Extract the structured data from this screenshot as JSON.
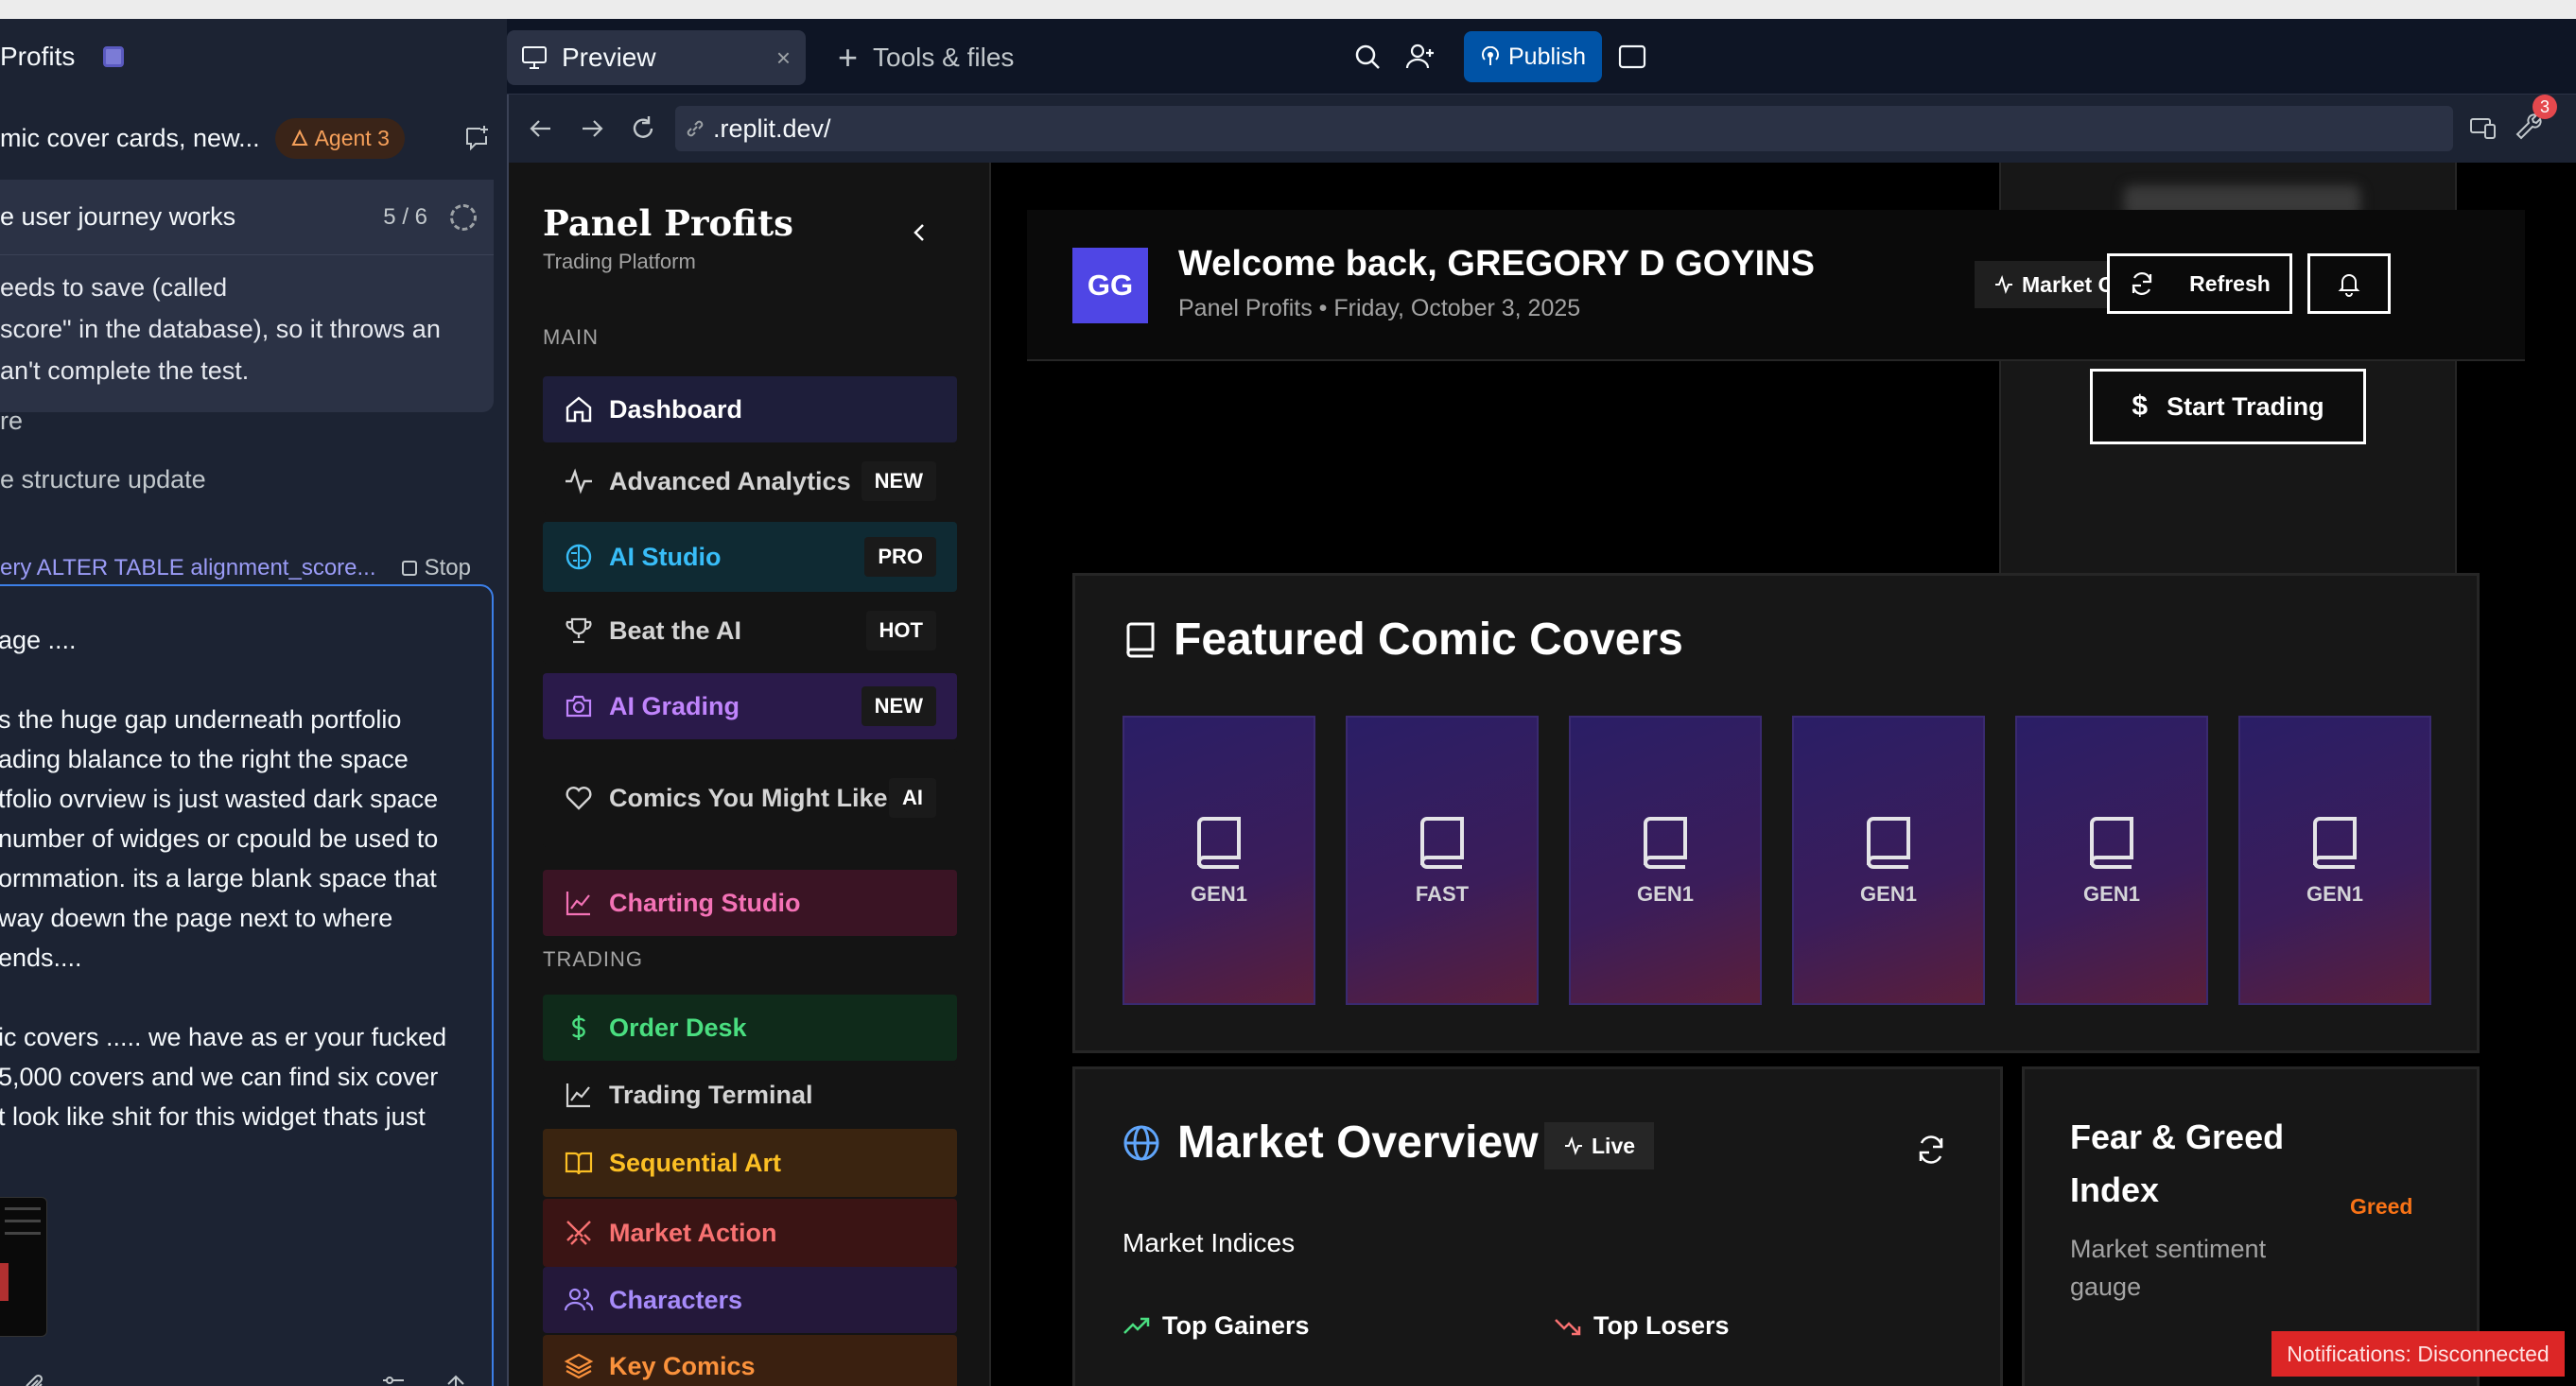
{
  "chat": {
    "project_title": "Profits",
    "thread_title": "mic cover cards, new...",
    "agent_badge": "Agent 3",
    "task_title": "e user journey works",
    "task_count": "5 / 6",
    "task_text": "eeds to save (called\nscore\" in the database), so it throws an\nan't complete the test.",
    "line_re": "re",
    "line_structure": "e structure update",
    "status_text": "ery ALTER TABLE alignment_score...",
    "stop_label": "Stop",
    "message_text": "age ....\n\ns the huge gap underneath portfolio\nading blalance to the right the space\ntfolio ovrview is just wasted dark space\nnumber of widges or cpould be used to\normmation. its a large blank space that\nway doewn the page next to where\n ends....\n\nic covers ..... we have as er your fucked\n5,000 covers and we can find six cover\nt look like shit for this widget thats just"
  },
  "workspace": {
    "tab_preview": "Preview",
    "tab_close": "×",
    "tab_tools": "Tools & files",
    "publish_label": "Publish",
    "url": ".replit.dev/",
    "wrench_badge": "3"
  },
  "sidebar": {
    "brand": "Panel Profits",
    "brand_sub": "Trading Platform",
    "section_main": "MAIN",
    "section_trading": "TRADING",
    "items": [
      {
        "label": "Dashboard",
        "badge": "",
        "icon": "home-icon",
        "color": "#ffffff",
        "bg": "#1e1e3a"
      },
      {
        "label": "Advanced Analytics",
        "badge": "NEW",
        "icon": "activity-icon",
        "color": "#d4d4d4",
        "bg": "#141414"
      },
      {
        "label": "AI Studio",
        "badge": "PRO",
        "icon": "brain-icon",
        "color": "#38bdf8",
        "bg": "#0f2a33"
      },
      {
        "label": "Beat the AI",
        "badge": "HOT",
        "icon": "trophy-icon",
        "color": "#d4d4d4",
        "bg": "#141414"
      },
      {
        "label": "AI Grading",
        "badge": "NEW",
        "icon": "camera-icon",
        "color": "#c084fc",
        "bg": "#2a1a4a"
      },
      {
        "label": "Comics You Might Like",
        "badge": "AI",
        "icon": "heart-icon",
        "color": "#d4d4d4",
        "bg": "#141414"
      },
      {
        "label": "Charting Studio",
        "badge": "",
        "icon": "chart-line-icon",
        "color": "#f472b6",
        "bg": "#3a1424"
      },
      {
        "label": "Order Desk",
        "badge": "",
        "icon": "dollar-icon",
        "color": "#4ade80",
        "bg": "#0f2a1a"
      },
      {
        "label": "Trading Terminal",
        "badge": "",
        "icon": "chart-line-icon",
        "color": "#d4d4d4",
        "bg": "#141414"
      },
      {
        "label": "Sequential Art",
        "badge": "",
        "icon": "book-open-icon",
        "color": "#fbbf24",
        "bg": "#3a2410"
      },
      {
        "label": "Market Action",
        "badge": "",
        "icon": "swords-icon",
        "color": "#f87171",
        "bg": "#3a1414"
      },
      {
        "label": "Characters",
        "badge": "",
        "icon": "users-icon",
        "color": "#a78bfa",
        "bg": "#24183a"
      },
      {
        "label": "Key Comics",
        "badge": "",
        "icon": "layers-icon",
        "color": "#fb923c",
        "bg": "#3a2010"
      }
    ]
  },
  "dashboard": {
    "avatar_initials": "GG",
    "welcome": "Welcome back, GREGORY D GOYINS",
    "subtitle": "Panel Profits • Friday, October 3, 2025",
    "market_open": "Market Open",
    "refresh_label": "Refresh",
    "start_trading": "Start Trading",
    "featured_title": "Featured Comic Covers",
    "covers": [
      "GEN1",
      "FAST",
      "GEN1",
      "GEN1",
      "GEN1",
      "GEN1"
    ],
    "market_title": "Market Overview",
    "live_label": "Live",
    "market_indices": "Market Indices",
    "top_gainers": "Top Gainers",
    "top_losers": "Top Losers",
    "fear_title": "Fear & Greed Index",
    "fear_sub": "Market sentiment gauge",
    "fear_value": "Greed"
  },
  "toast": "Notifications: Disconnected"
}
